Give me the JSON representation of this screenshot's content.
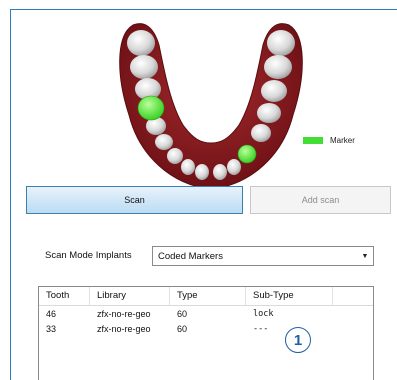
{
  "legend": {
    "label": "Marker",
    "color": "#44dd33"
  },
  "buttons": {
    "scan": "Scan",
    "add_scan": "Add scan"
  },
  "scan_mode": {
    "label": "Scan Mode Implants",
    "selected": "Coded Markers"
  },
  "table": {
    "columns": [
      "Tooth",
      "Library",
      "Type",
      "Sub-Type"
    ],
    "rows": [
      {
        "tooth": "46",
        "library": "zfx-no-re-geo",
        "type": "60",
        "subtype": "lock"
      },
      {
        "tooth": "33",
        "library": "zfx-no-re-geo",
        "type": "60",
        "subtype": "---"
      }
    ]
  },
  "annotation": {
    "number": "1"
  },
  "colors": {
    "accent": "#2a7dbf",
    "gum": "#8b1a1e",
    "tooth": "#dcdcdc",
    "marker": "#44dd33",
    "annotation": "#1f5fa3"
  }
}
